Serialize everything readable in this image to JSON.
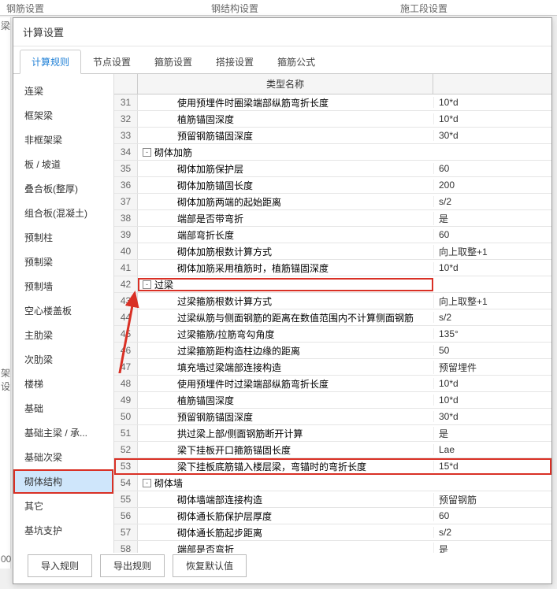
{
  "topTabs": [
    "钢筋设置",
    "钢结构设置",
    "施工段设置"
  ],
  "dialog": {
    "title": "计算设置"
  },
  "tabs": [
    "计算规则",
    "节点设置",
    "箍筋设置",
    "搭接设置",
    "箍筋公式"
  ],
  "activeTab": 0,
  "sidebar": [
    "连梁",
    "框架梁",
    "非框架梁",
    "板 / 坡道",
    "叠合板(整厚)",
    "组合板(混凝土)",
    "预制柱",
    "预制梁",
    "预制墙",
    "空心楼盖板",
    "主肋梁",
    "次肋梁",
    "楼梯",
    "基础",
    "基础主梁 / 承...",
    "基础次梁",
    "砌体结构",
    "其它",
    "基坑支护"
  ],
  "selectedSidebar": 16,
  "gridHeader": "类型名称",
  "rows": [
    {
      "n": 31,
      "indent": 2,
      "label": "使用预埋件时圈梁端部纵筋弯折长度",
      "val": "10*d"
    },
    {
      "n": 32,
      "indent": 2,
      "label": "植筋锚固深度",
      "val": "10*d"
    },
    {
      "n": 33,
      "indent": 2,
      "label": "预留钢筋锚固深度",
      "val": "30*d"
    },
    {
      "n": 34,
      "indent": 0,
      "toggle": "-",
      "label": "砌体加筋",
      "val": ""
    },
    {
      "n": 35,
      "indent": 2,
      "label": "砌体加筋保护层",
      "val": "60"
    },
    {
      "n": 36,
      "indent": 2,
      "label": "砌体加筋锚固长度",
      "val": "200"
    },
    {
      "n": 37,
      "indent": 2,
      "label": "砌体加筋两端的起始距离",
      "val": "s/2"
    },
    {
      "n": 38,
      "indent": 2,
      "label": "端部是否带弯折",
      "val": "是"
    },
    {
      "n": 39,
      "indent": 2,
      "label": "端部弯折长度",
      "val": "60"
    },
    {
      "n": 40,
      "indent": 2,
      "label": "砌体加筋根数计算方式",
      "val": "向上取整+1"
    },
    {
      "n": 41,
      "indent": 2,
      "label": "砌体加筋采用植筋时，植筋锚固深度",
      "val": "10*d"
    },
    {
      "n": 42,
      "indent": 0,
      "toggle": "-",
      "label": "过梁",
      "val": "",
      "hlCell": true
    },
    {
      "n": 43,
      "indent": 2,
      "label": "过梁箍筋根数计算方式",
      "val": "向上取整+1"
    },
    {
      "n": 44,
      "indent": 2,
      "label": "过梁纵筋与侧面钢筋的距离在数值范围内不计算侧面钢筋",
      "val": "s/2"
    },
    {
      "n": 45,
      "indent": 2,
      "label": "过梁箍筋/拉筋弯勾角度",
      "val": "135°"
    },
    {
      "n": 46,
      "indent": 2,
      "label": "过梁箍筋距构造柱边缘的距离",
      "val": "50"
    },
    {
      "n": 47,
      "indent": 2,
      "label": "填充墙过梁端部连接构造",
      "val": "预留埋件"
    },
    {
      "n": 48,
      "indent": 2,
      "label": "使用预埋件时过梁端部纵筋弯折长度",
      "val": "10*d"
    },
    {
      "n": 49,
      "indent": 2,
      "label": "植筋锚固深度",
      "val": "10*d"
    },
    {
      "n": 50,
      "indent": 2,
      "label": "预留钢筋锚固深度",
      "val": "30*d"
    },
    {
      "n": 51,
      "indent": 2,
      "label": "拱过梁上部/侧面钢筋断开计算",
      "val": "是"
    },
    {
      "n": 52,
      "indent": 2,
      "label": "梁下挂板开口箍筋锚固长度",
      "val": "Lae"
    },
    {
      "n": 53,
      "indent": 2,
      "label": "梁下挂板底筋锚入楼层梁，弯锚时的弯折长度",
      "val": "15*d",
      "hlRow": true
    },
    {
      "n": 54,
      "indent": 0,
      "toggle": "-",
      "label": "砌体墙",
      "val": ""
    },
    {
      "n": 55,
      "indent": 2,
      "label": "砌体墙端部连接构造",
      "val": "预留钢筋"
    },
    {
      "n": 56,
      "indent": 2,
      "label": "砌体通长筋保护层厚度",
      "val": "60"
    },
    {
      "n": 57,
      "indent": 2,
      "label": "砌体通长筋起步距离",
      "val": "s/2"
    },
    {
      "n": 58,
      "indent": 2,
      "label": "端部是否弯折",
      "val": "是"
    }
  ],
  "buttons": {
    "import": "导入规则",
    "export": "导出规则",
    "restore": "恢复默认值"
  },
  "leftStrip": [
    "梁",
    "架设",
    "",
    "00"
  ]
}
